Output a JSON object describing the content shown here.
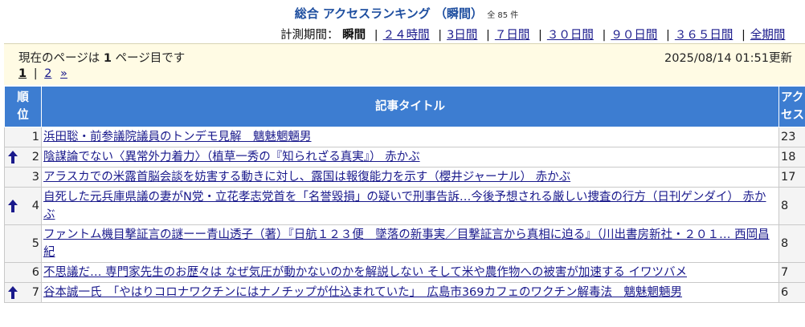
{
  "header": {
    "title": "総合 アクセスランキング （瞬間）",
    "count": "全 85 件"
  },
  "periods": {
    "label": "計測期間：",
    "current": "瞬間",
    "links": [
      "２４時間",
      "3日間",
      "７日間",
      "３０日間",
      "９０日間",
      "３６５日間",
      "全期間"
    ]
  },
  "status": {
    "prefix": "現在のページは ",
    "page": "1",
    "suffix": " ページ目です",
    "updated": "2025/08/14 01:51更新"
  },
  "pager": {
    "current": "1",
    "separator": "|",
    "next_page": "2",
    "next": "»"
  },
  "table": {
    "headers": {
      "rank": "順位",
      "title": "記事タイトル",
      "access": "アクセス"
    },
    "rows": [
      {
        "rank": "1",
        "up": false,
        "title": "浜田聡・前参議院議員のトンデモ見解　魑魅魍魎男",
        "access": "23"
      },
      {
        "rank": "2",
        "up": true,
        "title": "陰謀論でない〈異常外力着力〉（植草一秀の『知られざる真実』） 赤かぶ",
        "access": "18"
      },
      {
        "rank": "3",
        "up": false,
        "title": "アラスカでの米露首脳会談を妨害する動きに対し、露国は報復能力を示す（櫻井ジャーナル） 赤かぶ",
        "access": "17"
      },
      {
        "rank": "4",
        "up": true,
        "title": "自死した元兵庫県議の妻がN党・立花孝志党首を「名誉毀損」の疑いで刑事告訴…今後予想される厳しい捜査の行方（日刊ゲンダイ） 赤かぶ",
        "access": "8"
      },
      {
        "rank": "5",
        "up": false,
        "title": "ファントム機目撃証言の謎ーー青山透子（著）『日航１２３便　墜落の新事実／目撃証言から真相に迫る』（川出書房新社・２０１… 西岡昌紀",
        "access": "8"
      },
      {
        "rank": "6",
        "up": false,
        "title": "不思議だ… 専門家先生のお歴々は なぜ気圧が動かないのかを解説しない そして米や農作物への被害が加速する イワツバメ",
        "access": "7"
      },
      {
        "rank": "7",
        "up": true,
        "title": "谷本誠一氏　「やはりコロナワクチンにはナノチップが仕込まれていた」　広島市369カフェのワクチン解毒法　魑魅魍魎男",
        "access": "6"
      }
    ]
  },
  "colors": {
    "header_bg": "#3d7dd1",
    "title_text": "#1f4fa0",
    "link": "#1a1a8c",
    "info_bg": "#fffbe4",
    "arrow": "#1a1a8c"
  }
}
